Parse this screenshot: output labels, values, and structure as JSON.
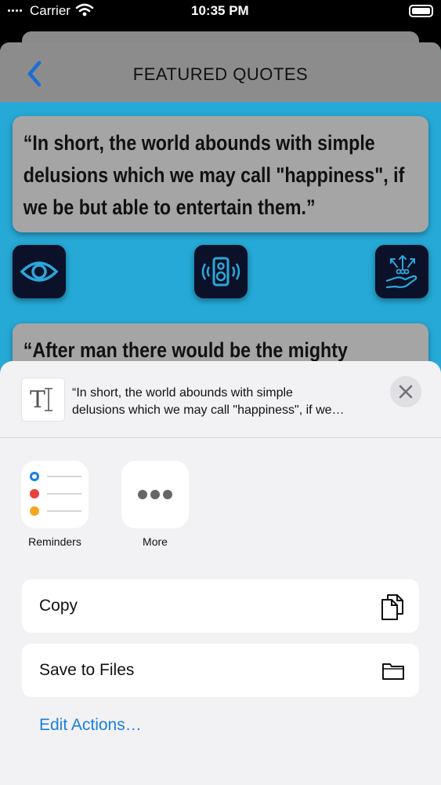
{
  "status_bar": {
    "carrier": "Carrier",
    "time": "10:35 PM"
  },
  "nav": {
    "title": "FEATURED QUOTES",
    "back_icon": "chevron-left-icon"
  },
  "quotes": [
    {
      "text": "“In short, the world abounds with simple delusions which we may call \"happiness\", if we be but able to entertain them.”"
    },
    {
      "text": "“After man there would be the mighty"
    }
  ],
  "quote_actions": [
    {
      "icon": "eye-icon"
    },
    {
      "icon": "speaker-icon"
    },
    {
      "icon": "share-hand-icon"
    }
  ],
  "share_sheet": {
    "preview_line1": "“In short, the world abounds with simple",
    "preview_line2": "delusions which we may call \"happiness\", if we…",
    "thumb_glyph": "T",
    "apps": [
      {
        "label": "Reminders",
        "icon": "reminders-icon"
      },
      {
        "label": "More",
        "icon": "more-icon"
      }
    ],
    "actions": [
      {
        "label": "Copy",
        "icon": "copy-icon"
      },
      {
        "label": "Save to Files",
        "icon": "folder-icon"
      }
    ],
    "edit_actions": "Edit Actions…"
  },
  "colors": {
    "accent": "#1a7fe0",
    "app_background": "#26a9d6",
    "quote_card": "#a5a5a5",
    "action_button": "#0a1128"
  }
}
